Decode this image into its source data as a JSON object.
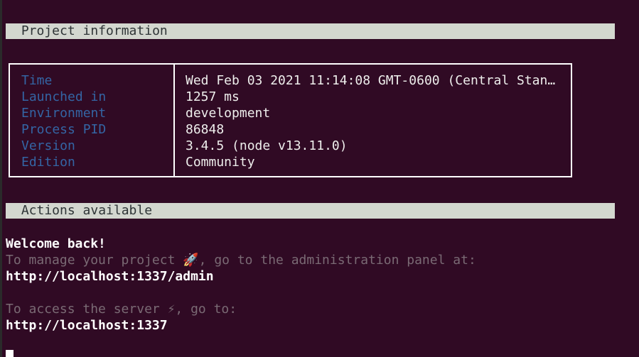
{
  "sections": {
    "project_title": " Project information",
    "actions_title": " Actions available"
  },
  "info": {
    "rows": [
      {
        "key": "Time",
        "value": "Wed Feb 03 2021 11:14:08 GMT-0600 (Central Stan…"
      },
      {
        "key": "Launched in",
        "value": "1257 ms"
      },
      {
        "key": "Environment",
        "value": "development"
      },
      {
        "key": "Process PID",
        "value": "86848"
      },
      {
        "key": "Version",
        "value": "3.4.5 (node v13.11.0)"
      },
      {
        "key": "Edition",
        "value": "Community"
      }
    ]
  },
  "actions": {
    "welcome": "Welcome back!",
    "admin_hint": "To manage your project 🚀, go to the administration panel at:",
    "admin_url": "http://localhost:1337/admin",
    "server_hint": "To access the server ⚡, go to:",
    "server_url": "http://localhost:1337"
  },
  "colors": {
    "background": "#300a24",
    "key_text": "#3465a4",
    "bar_background": "#d3d7cf",
    "dim_text": "#7a6a74"
  }
}
